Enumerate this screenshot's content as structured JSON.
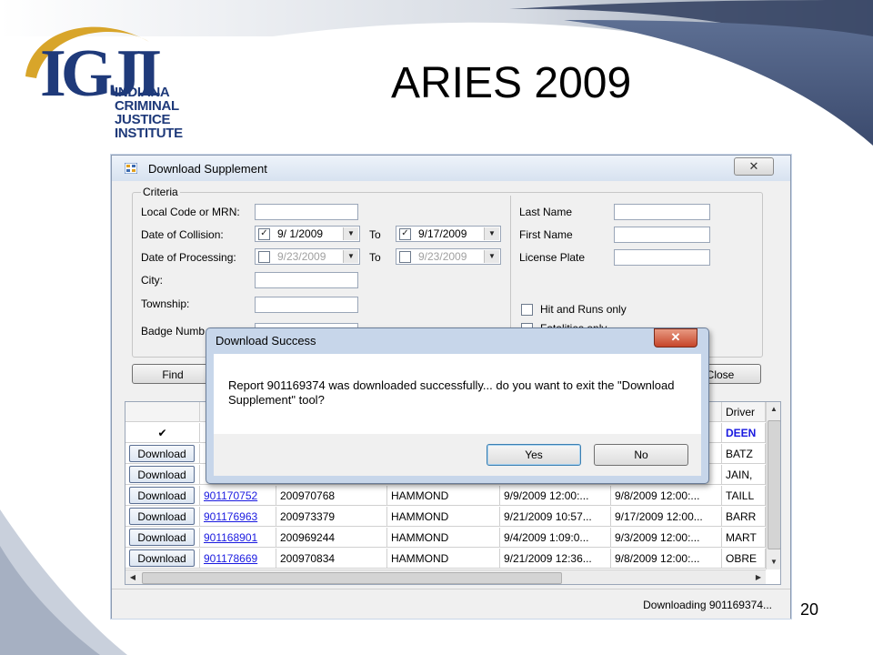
{
  "slide": {
    "title": "ARIES 2009",
    "page_number": "20",
    "logo": {
      "letters": "IGJI",
      "lines": [
        "INDIANA",
        "CRIMINAL",
        "JUSTICE",
        "INSTITUTE"
      ]
    }
  },
  "window": {
    "title": "Download Supplement",
    "close_glyph": "✕",
    "criteria": {
      "legend": "Criteria",
      "left": {
        "local_code_label": "Local Code or MRN:",
        "local_code_value": "",
        "date_collision_label": "Date of Collision:",
        "date_collision_from": "9/ 1/2009",
        "date_collision_to": "9/17/2009",
        "date_processing_label": "Date of Processing:",
        "date_processing_from": "9/23/2009",
        "date_processing_to": "9/23/2009",
        "to_label": "To",
        "city_label": "City:",
        "township_label": "Township:",
        "badge_label": "Badge Numb"
      },
      "right": {
        "last_name_label": "Last Name",
        "first_name_label": "First Name",
        "license_plate_label": "License Plate",
        "hit_runs_label": "Hit and Runs only",
        "fatalities_label": "Fatalities only"
      }
    },
    "buttons": {
      "find": "Find",
      "close": "Close"
    },
    "grid": {
      "header_last": "Driver",
      "check_glyph": "✔",
      "row_button_label": "Download",
      "rows": [
        {
          "report": "",
          "local": "",
          "city": "",
          "date1": "",
          "date2": "",
          "driver": "DEEN"
        },
        {
          "report": "",
          "local": "",
          "city": "",
          "date1": "",
          "date2": "",
          "driver": "BATZ"
        },
        {
          "report": "",
          "local": "",
          "city": "",
          "date1": "",
          "date2": "",
          "driver": "JAIN,"
        },
        {
          "report": "901170752",
          "local": "200970768",
          "city": "HAMMOND",
          "date1": "9/9/2009 12:00:...",
          "date2": "9/8/2009 12:00:...",
          "driver": "TAILL"
        },
        {
          "report": "901176963",
          "local": "200973379",
          "city": "HAMMOND",
          "date1": "9/21/2009 10:57...",
          "date2": "9/17/2009 12:00...",
          "driver": "BARR"
        },
        {
          "report": "901168901",
          "local": "200969244",
          "city": "HAMMOND",
          "date1": "9/4/2009 1:09:0...",
          "date2": "9/3/2009 12:00:...",
          "driver": "MART"
        },
        {
          "report": "901178669",
          "local": "200970834",
          "city": "HAMMOND",
          "date1": "9/21/2009 12:36...",
          "date2": "9/8/2009 12:00:...",
          "driver": "OBRE"
        }
      ]
    },
    "status": "Downloading 901169374..."
  },
  "dialog": {
    "title": "Download Success",
    "close_glyph": "✕",
    "message": "Report 901169374 was downloaded successfully... do you want to exit the \"Download Supplement\" tool?",
    "yes": "Yes",
    "no": "No"
  },
  "colors": {
    "logo_blue": "#1f3a7a",
    "logo_gold": "#d8a52a",
    "link_blue": "#1a1ae0",
    "driver_highlight": "#1a1ae0"
  }
}
